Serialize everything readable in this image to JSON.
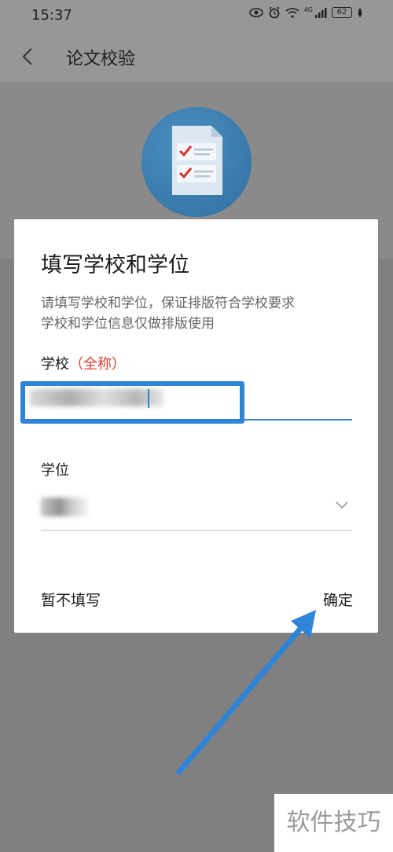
{
  "status_bar": {
    "time": "15:37",
    "battery": "62",
    "network": "4G"
  },
  "header": {
    "title": "论文校验",
    "back_icon": "chevron-left-icon"
  },
  "dialog": {
    "title": "填写学校和学位",
    "description_line1": "请填写学校和学位，保证排版符合学校要求",
    "description_line2": "学校和学位信息仅做排版使用",
    "school_label": "学校",
    "school_required_note": "（全称）",
    "school_value": "",
    "degree_label": "学位",
    "degree_value": "",
    "skip_button": "暂不填写",
    "confirm_button": "确定"
  },
  "colors": {
    "accent": "#2e84d8",
    "required": "#e03b2f",
    "overlay": "#808080"
  },
  "watermark": "软件技巧"
}
